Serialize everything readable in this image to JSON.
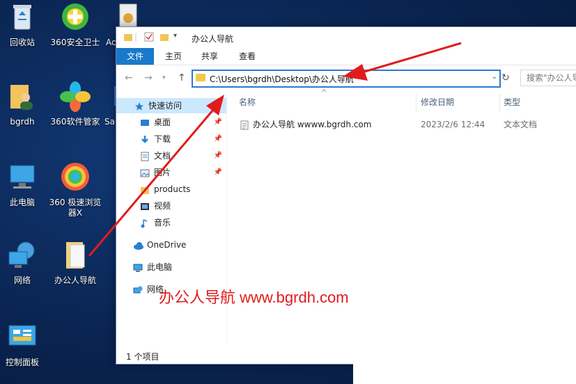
{
  "desktop": {
    "icons": [
      {
        "label": "回收站"
      },
      {
        "label": "360安全卫士"
      },
      {
        "label": "Ac"
      },
      {
        "label": "bgrdh"
      },
      {
        "label": "360软件管家"
      },
      {
        "label": "Sa"
      },
      {
        "label": "此电脑"
      },
      {
        "label": "360 极速浏览器X"
      },
      {
        "label": "网络"
      },
      {
        "label": "办公人导航"
      },
      {
        "label": "控制面板"
      }
    ]
  },
  "window": {
    "title": "办公人导航",
    "ribbon_tabs": [
      "文件",
      "主页",
      "共享",
      "查看"
    ],
    "address": "C:\\Users\\bgrdh\\Desktop\\办公人导航",
    "search_placeholder": "搜索\"办公人导",
    "sidebar": [
      {
        "label": "快速访问",
        "icon": "star-icon"
      },
      {
        "label": "桌面",
        "icon": "desktop-icon"
      },
      {
        "label": "下载",
        "icon": "download-icon"
      },
      {
        "label": "文档",
        "icon": "document-icon"
      },
      {
        "label": "图片",
        "icon": "picture-icon"
      },
      {
        "label": "products",
        "icon": "folder-icon"
      },
      {
        "label": "视频",
        "icon": "video-icon"
      },
      {
        "label": "音乐",
        "icon": "music-icon"
      },
      {
        "label": "OneDrive",
        "icon": "cloud-icon"
      },
      {
        "label": "此电脑",
        "icon": "computer-icon"
      },
      {
        "label": "网络",
        "icon": "network-icon"
      }
    ],
    "columns": [
      "名称",
      "修改日期",
      "类型"
    ],
    "files": [
      {
        "name": "办公人导航 wwww.bgrdh.com",
        "date": "2023/2/6 12:44",
        "type": "文本文档"
      }
    ],
    "status": "1 个项目"
  },
  "watermark": "办公人导航 www.bgrdh.com",
  "colors": {
    "accent": "#1979ca",
    "arrow": "#e11c1c",
    "selection": "#cce8ff"
  }
}
